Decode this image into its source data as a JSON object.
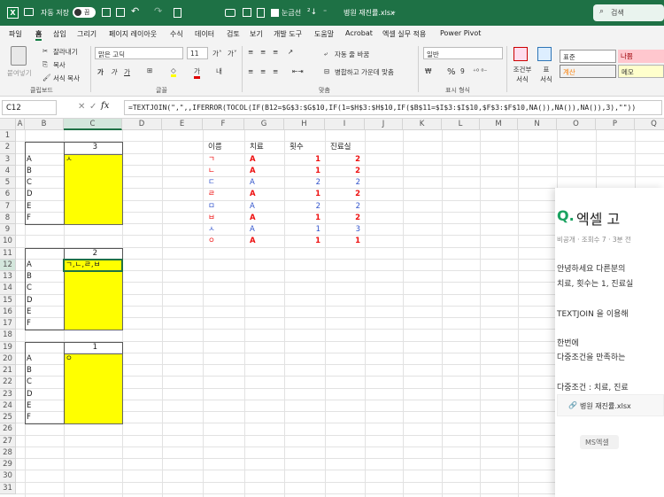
{
  "titlebar": {
    "autosave": "자동 저장",
    "toggle": "끔",
    "marking": "눈금선",
    "filename": "병원 재진률.xlsx",
    "search": "검색"
  },
  "menu": [
    "파일",
    "홈",
    "삽입",
    "그리기",
    "페이지 레이아웃",
    "수식",
    "데이터",
    "검토",
    "보기",
    "개발 도구",
    "도움말",
    "Acrobat",
    "엑셀 실무 적용",
    "Power Pivot"
  ],
  "ribbon": {
    "paste": "붙여넣기",
    "cut": "잘라내기",
    "copy": "복사",
    "format_painter": "서식 복사",
    "clipboard": "클립보드",
    "font_name": "맑은 고딕",
    "font_size": "11",
    "font_group": "글꼴",
    "wrap": "자동 줄 바꿈",
    "merge": "병합하고 가운데 맞춤",
    "align_group": "맞춤",
    "number_format": "일반",
    "number_group": "표시 형식",
    "cond_format": "조건부 서식",
    "table_format": "표 서식",
    "style_normal": "표준",
    "style_bad": "나쁨",
    "style_calc": "계산",
    "style_memo": "메모"
  },
  "formula_bar": {
    "name_box": "C12",
    "fx": "fx",
    "formula": "=TEXTJOIN(\",\",,IFERROR(TOCOL(IF(B12=$G$3:$G$10,IF(1=$H$3:$H$10,IF($B$11=$I$3:$I$10,$F$3:$F$10,NA()),NA()),NA()),3),\"\"))"
  },
  "columns": [
    "A",
    "B",
    "C",
    "D",
    "E",
    "F",
    "G",
    "H",
    "I",
    "J",
    "K",
    "L",
    "M",
    "N",
    "O",
    "P",
    "Q"
  ],
  "rows": [
    "1",
    "2",
    "3",
    "4",
    "5",
    "6",
    "7",
    "8",
    "9",
    "10",
    "11",
    "12",
    "13",
    "14",
    "15",
    "16",
    "17",
    "18",
    "19",
    "20",
    "21",
    "22",
    "23",
    "24",
    "25",
    "26",
    "27",
    "28",
    "29",
    "30",
    "31"
  ],
  "blocks": [
    {
      "value": "3",
      "labels": [
        "A",
        "B",
        "C",
        "D",
        "E",
        "F"
      ],
      "results": [
        "ㅅ",
        "",
        "",
        "",
        "",
        ""
      ]
    },
    {
      "value": "2",
      "labels": [
        "A",
        "B",
        "C",
        "D",
        "E",
        "F"
      ],
      "results": [
        "ㄱ,ㄴ,ㄹ,ㅂ",
        "",
        "",
        "",
        "",
        ""
      ]
    },
    {
      "value": "1",
      "labels": [
        "A",
        "B",
        "C",
        "D",
        "E",
        "F"
      ],
      "results": [
        "ㅇ",
        "",
        "",
        "",
        "",
        ""
      ]
    }
  ],
  "table": {
    "headers": [
      "이름",
      "치료",
      "횟수",
      "진료실"
    ],
    "rows": [
      [
        "ㄱ",
        "A",
        "1",
        "2"
      ],
      [
        "ㄴ",
        "A",
        "1",
        "2"
      ],
      [
        "ㄷ",
        "A",
        "2",
        "2"
      ],
      [
        "ㄹ",
        "A",
        "1",
        "2"
      ],
      [
        "ㅁ",
        "A",
        "2",
        "2"
      ],
      [
        "ㅂ",
        "A",
        "1",
        "2"
      ],
      [
        "ㅅ",
        "A",
        "1",
        "3"
      ],
      [
        "ㅇ",
        "A",
        "1",
        "1"
      ]
    ],
    "red_rows": [
      0,
      1,
      3,
      5,
      7
    ],
    "colors": {
      "red": "#ee1111",
      "blue": "#3355cc"
    }
  },
  "popup": {
    "title": "엑셀 고",
    "meta": "비공개 · 조회수 7 · 3분 전",
    "line1": "안녕하세요 다른분의",
    "line2": "치료, 횟수는 1, 진료실",
    "line3": "TEXTJOIN 을 이용해",
    "line4": "한번에",
    "line5": "다중조건을 만족하는",
    "line6": "다중조건 : 치료, 진료",
    "attachment": "병원 재진률.xlsx",
    "tag": "MS엑셀"
  }
}
